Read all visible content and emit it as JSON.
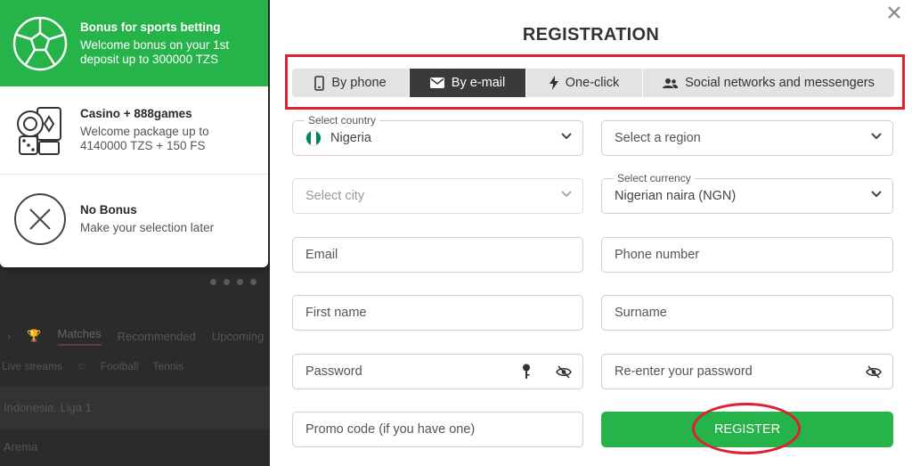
{
  "background": {
    "tabs": [
      "Matches",
      "Recommended",
      "Upcoming"
    ],
    "sports": [
      "Live streams",
      "Football",
      "Tennis"
    ],
    "league": "Indonesia. Liga 1",
    "team": "Arema"
  },
  "bonuses": [
    {
      "title": "Bonus for sports betting",
      "desc": "Welcome bonus on your 1st deposit up to 300000 TZS",
      "icon": "football-icon",
      "active": true
    },
    {
      "title": "Casino + 888games",
      "desc": "Welcome package up to 4140000 TZS + 150 FS",
      "icon": "casino-chips-icon",
      "active": false
    },
    {
      "title": "No Bonus",
      "desc": "Make your selection later",
      "icon": "no-bonus-icon",
      "active": false
    }
  ],
  "modal": {
    "title": "REGISTRATION",
    "tabs": [
      {
        "label": "By phone",
        "icon": "phone-icon"
      },
      {
        "label": "By e-mail",
        "icon": "envelope-icon"
      },
      {
        "label": "One-click",
        "icon": "lightning-icon"
      },
      {
        "label": "Social networks and messengers",
        "icon": "users-icon"
      }
    ],
    "active_tab": "By e-mail",
    "fields": {
      "country_label": "Select country",
      "country_value": "Nigeria",
      "region_placeholder": "Select a region",
      "city_placeholder": "Select city",
      "currency_label": "Select currency",
      "currency_value": "Nigerian naira (NGN)",
      "email_placeholder": "Email",
      "phone_placeholder": "Phone number",
      "first_name_placeholder": "First name",
      "surname_placeholder": "Surname",
      "password_placeholder": "Password",
      "reenter_password_placeholder": "Re-enter your password",
      "promo_placeholder": "Promo code (if you have one)"
    },
    "register_label": "REGISTER"
  },
  "colors": {
    "accent_green": "#26b34a",
    "active_tab_dark": "#3a3a3a",
    "highlight_red": "#e0202e",
    "flag_green": "#008751"
  }
}
